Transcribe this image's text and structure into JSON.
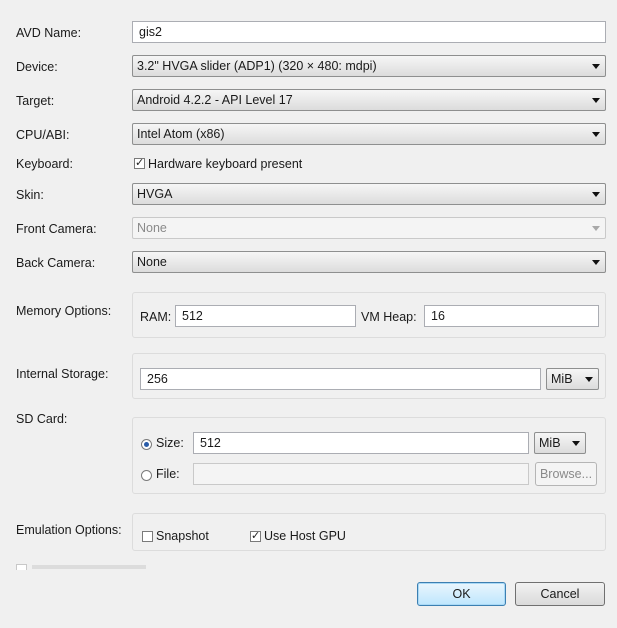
{
  "avd_name": {
    "label": "AVD Name:",
    "value": "gis2"
  },
  "device": {
    "label": "Device:",
    "value": "3.2\" HVGA slider (ADP1) (320 × 480: mdpi)"
  },
  "target": {
    "label": "Target:",
    "value": "Android 4.2.2 - API Level 17"
  },
  "cpu_abi": {
    "label": "CPU/ABI:",
    "value": "Intel Atom (x86)"
  },
  "keyboard": {
    "label": "Keyboard:",
    "checkbox_label": "Hardware keyboard present",
    "checked": true
  },
  "skin": {
    "label": "Skin:",
    "value": "HVGA"
  },
  "front_camera": {
    "label": "Front Camera:",
    "value": "None",
    "disabled": true
  },
  "back_camera": {
    "label": "Back Camera:",
    "value": "None"
  },
  "memory": {
    "label": "Memory Options:",
    "ram_label": "RAM:",
    "ram_value": "512",
    "vm_heap_label": "VM Heap:",
    "vm_heap_value": "16"
  },
  "internal_storage": {
    "label": "Internal Storage:",
    "value": "256",
    "unit": "MiB"
  },
  "sd_card": {
    "label": "SD Card:",
    "size_label": "Size:",
    "size_value": "512",
    "size_unit": "MiB",
    "size_selected": true,
    "file_label": "File:",
    "file_value": "",
    "browse_label": "Browse..."
  },
  "emulation": {
    "label": "Emulation Options:",
    "snapshot_label": "Snapshot",
    "snapshot_checked": false,
    "gpu_label": "Use Host GPU",
    "gpu_checked": true
  },
  "buttons": {
    "ok": "OK",
    "cancel": "Cancel"
  }
}
